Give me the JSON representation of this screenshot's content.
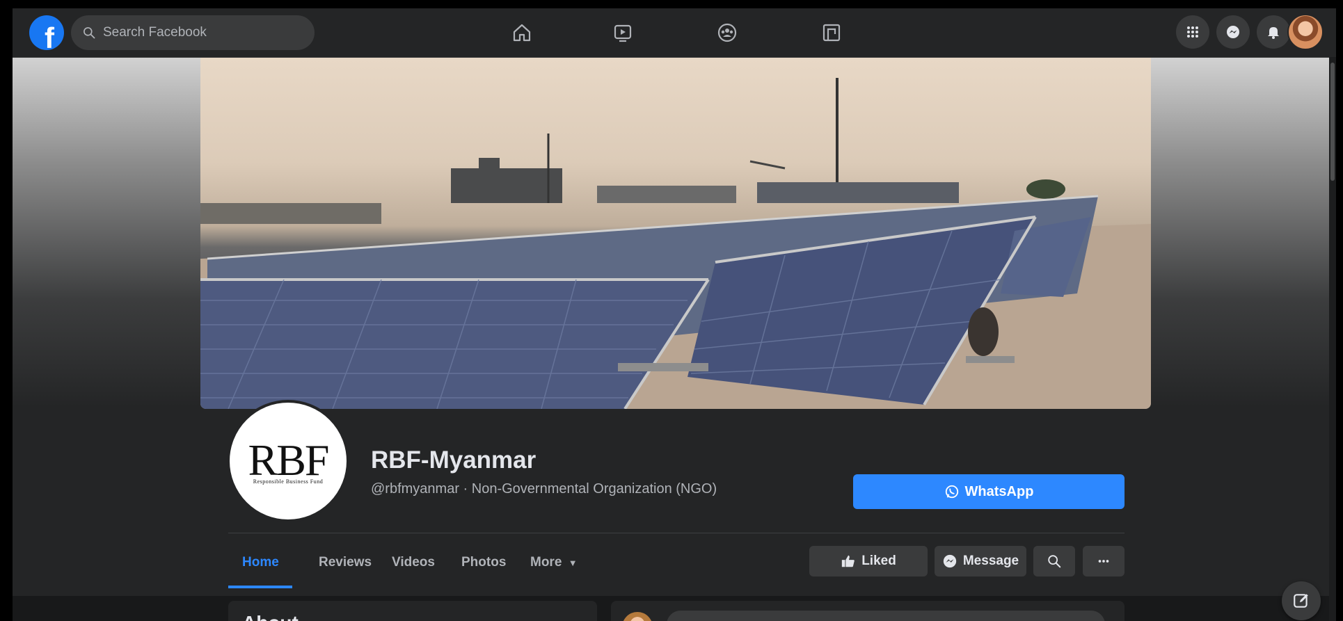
{
  "search": {
    "placeholder": "Search Facebook"
  },
  "nav": {
    "center_icons": [
      "home-icon",
      "watch-icon",
      "groups-icon",
      "gaming-icon"
    ],
    "right_icons": [
      "menu-grid-icon",
      "messenger-icon",
      "notifications-icon",
      "account-avatar"
    ]
  },
  "page": {
    "name": "RBF-Myanmar",
    "meta": "@rbfmyanmar · Non-Governmental Organization (NGO)",
    "logo_text": "RBF",
    "logo_subtext": "Responsible  Business  Fund"
  },
  "primary_action": {
    "label": "WhatsApp",
    "icon": "whatsapp-icon"
  },
  "tabs": [
    {
      "label": "Home",
      "active": true
    },
    {
      "label": "Reviews",
      "active": false
    },
    {
      "label": "Videos",
      "active": false
    },
    {
      "label": "Photos",
      "active": false
    },
    {
      "label": "More",
      "active": false
    }
  ],
  "actions": {
    "liked": "Liked",
    "message": "Message",
    "search_icon": "search-icon",
    "more_icon": "more-dots-icon"
  },
  "sections": {
    "about_heading": "About"
  },
  "colors": {
    "accent": "#2d88ff",
    "brand": "#1877f2",
    "surface": "#242526",
    "background": "#18191a"
  }
}
